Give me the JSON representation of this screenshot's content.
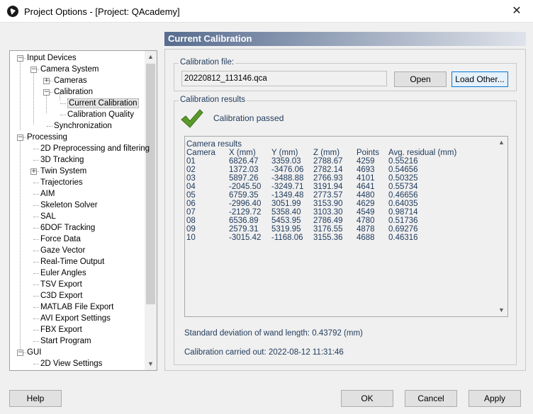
{
  "window": {
    "title": "Project Options - [Project: QAcademy]",
    "close_glyph": "✕"
  },
  "tree": {
    "scroll_up": "▲",
    "scroll_down": "▼",
    "items": [
      {
        "label": "Input Devices",
        "toggle": "−"
      },
      {
        "label": "Camera System",
        "toggle": "−"
      },
      {
        "label": "Cameras",
        "toggle": "+"
      },
      {
        "label": "Calibration",
        "toggle": "−"
      },
      {
        "label": "Current Calibration",
        "selected": true
      },
      {
        "label": "Calibration Quality"
      },
      {
        "label": "Synchronization"
      },
      {
        "label": "Processing",
        "toggle": "−"
      },
      {
        "label": "2D Preprocessing and filtering"
      },
      {
        "label": "3D Tracking"
      },
      {
        "label": "Twin System",
        "toggle": "+"
      },
      {
        "label": "Trajectories"
      },
      {
        "label": "AIM"
      },
      {
        "label": "Skeleton Solver"
      },
      {
        "label": "SAL"
      },
      {
        "label": "6DOF Tracking"
      },
      {
        "label": "Force Data"
      },
      {
        "label": "Gaze Vector"
      },
      {
        "label": "Real-Time Output"
      },
      {
        "label": "Euler Angles"
      },
      {
        "label": "TSV Export"
      },
      {
        "label": "C3D Export"
      },
      {
        "label": "MATLAB File Export"
      },
      {
        "label": "AVI Export Settings"
      },
      {
        "label": "FBX Export"
      },
      {
        "label": "Start Program"
      },
      {
        "label": "GUI",
        "toggle": "−"
      },
      {
        "label": "2D View Settings"
      }
    ]
  },
  "panel": {
    "header": "Current Calibration",
    "file_group_title": "Calibration file:",
    "file_value": "20220812_113146.qca",
    "open_button": "Open",
    "load_other_button": "Load Other...",
    "results_group_title": "Calibration results",
    "status": "Calibration passed",
    "results_title": "Camera results",
    "columns": [
      "Camera",
      "X (mm)",
      "Y (mm)",
      "Z (mm)",
      "Points",
      "Avg. residual (mm)"
    ],
    "rows": [
      [
        "01",
        "6826.47",
        "3359.03",
        "2788.67",
        "4259",
        "0.55216"
      ],
      [
        "02",
        "1372.03",
        "-3476.06",
        "2782.14",
        "4693",
        "0.54656"
      ],
      [
        "03",
        "5897.26",
        "-3488.88",
        "2766.93",
        "4101",
        "0.50325"
      ],
      [
        "04",
        "-2045.50",
        "-3249.71",
        "3191.94",
        "4641",
        "0.55734"
      ],
      [
        "05",
        "6759.35",
        "-1349.48",
        "2773.57",
        "4480",
        "0.46656"
      ],
      [
        "06",
        "-2996.40",
        "3051.99",
        "3153.90",
        "4629",
        "0.64035"
      ],
      [
        "07",
        "-2129.72",
        "5358.40",
        "3103.30",
        "4549",
        "0.98714"
      ],
      [
        "08",
        "6536.89",
        "5453.95",
        "2786.49",
        "4780",
        "0.51736"
      ],
      [
        "09",
        "2579.31",
        "5319.95",
        "3176.55",
        "4878",
        "0.69276"
      ],
      [
        "10",
        "-3015.42",
        "-1168.06",
        "3155.36",
        "4688",
        "0.46316"
      ]
    ],
    "std_dev": "Standard deviation of wand length:  0.43792 (mm)",
    "carried_out": "Calibration carried out: 2022-08-12 11:31:46",
    "scroll_up": "▲",
    "scroll_down": "▼"
  },
  "buttons": {
    "help": "Help",
    "ok": "OK",
    "cancel": "Cancel",
    "apply": "Apply"
  },
  "colors": {
    "header_gradient_start": "#576c8f",
    "text_blue": "#1e395b",
    "check_green": "#5a9a2a",
    "focus_border": "#0078d7"
  },
  "icons": [
    "app-logo-icon",
    "close-icon",
    "collapse-icon",
    "expand-icon",
    "check-icon",
    "scroll-up-icon",
    "scroll-down-icon"
  ]
}
